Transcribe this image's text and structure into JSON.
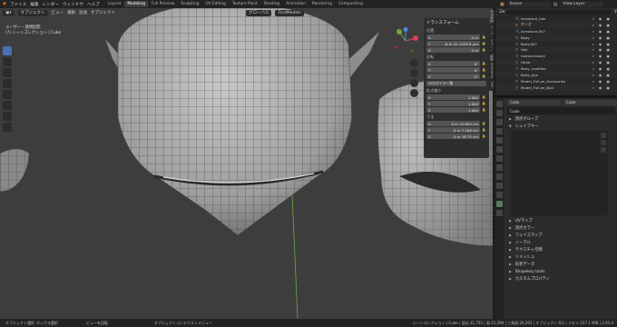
{
  "topbar": {
    "menu": [
      "ファイル",
      "編集",
      "レンダー",
      "ウィンドウ",
      "ヘルプ"
    ],
    "workspaces": [
      "Layout",
      "Modeling",
      "Full Preview",
      "Sculpting",
      "UV Editing",
      "Texture Paint",
      "Shading",
      "Animation",
      "Rendering",
      "Compositing"
    ],
    "active_workspace": "Modeling",
    "scene": "Scene",
    "view_layer": "View Layer"
  },
  "viewport": {
    "header": [
      "オブジェクト",
      "ビュー",
      "選択",
      "追加",
      "オブジェクト"
    ],
    "orientation_label": "グローバル",
    "view_name": "ユーザー・透視投影",
    "collection_line": "(7) シーンコレクション | Cube",
    "find_label": "FindModels"
  },
  "npanel": {
    "title": "トランスフォーム",
    "location_label": "位置",
    "location": [
      {
        "axis": "X",
        "value": "0 m"
      },
      {
        "axis": "Y",
        "value": "-6 m 41.1433,9 μm"
      },
      {
        "axis": "Z",
        "value": "0 m"
      }
    ],
    "rotation_label": "回転",
    "rotation": [
      {
        "axis": "X",
        "value": "0°"
      },
      {
        "axis": "Y",
        "value": "0°"
      },
      {
        "axis": "Z",
        "value": "0°"
      }
    ],
    "rotation_mode": "XYZオイラー角",
    "scale_label": "拡大縮小",
    "scale": [
      {
        "axis": "X",
        "value": "1.000"
      },
      {
        "axis": "Y",
        "value": "1.000"
      },
      {
        "axis": "Z",
        "value": "1.000"
      }
    ],
    "dimensions_label": "寸法",
    "dimensions": [
      {
        "axis": "X",
        "value": "0 m 13.694 cm"
      },
      {
        "axis": "Y",
        "value": "0 m 7.168 cm"
      },
      {
        "axis": "Z",
        "value": "0 m 16.75 cm"
      }
    ],
    "tabs": [
      "アイテム",
      "ツール",
      "ビュー",
      "編集",
      "Animation",
      "Edit"
    ]
  },
  "outliner": {
    "rows": [
      {
        "name": "Armature_hair",
        "icon": "armature"
      },
      {
        "name": "ポーズ",
        "icon": "pose"
      },
      {
        "name": "Armature.007",
        "icon": "armature"
      },
      {
        "name": "Body",
        "icon": "mesh"
      },
      {
        "name": "Body.007",
        "icon": "mesh"
      },
      {
        "name": "Hair",
        "icon": "mesh"
      },
      {
        "name": "hairaccessory",
        "icon": "mesh"
      },
      {
        "name": "Head",
        "icon": "mesh"
      },
      {
        "name": "Body_modifier",
        "icon": "mesh"
      },
      {
        "name": "Body_eye",
        "icon": "mesh"
      },
      {
        "name": "Model_Full.pe_Accesories",
        "icon": "mesh"
      },
      {
        "name": "Model_Full.pe_Bod",
        "icon": "mesh"
      }
    ]
  },
  "properties": {
    "object_name": "Cube",
    "data_name": "Cube",
    "name_field": "Cube",
    "sections_top": [
      "頂点グループ",
      "シェイプキー"
    ],
    "sections_bottom": [
      "UVマップ",
      "頂点カラー",
      "フェイスマップ",
      "ノーマル",
      "テクスチャ空間",
      "リメッシュ",
      "形状データ",
      "Shapekey tools",
      "カスタムプロパティ"
    ]
  },
  "statusbar": {
    "left": "オブジェクト選択",
    "left2": "ボックス選択",
    "mid": "ビューを回転",
    "mid2": "オブジェクトコンテクストメニュー",
    "right": "シーンコレクション | Cube | 頂点:11,752 | 面:11,294 | 三角面:20,291 | オブジェクト:0/1 | メモリ:257.1 MiB | 2.93.4"
  },
  "colors": {
    "accent": "#4772b3",
    "viewport_bg": "#3d3d3d",
    "panel_bg": "#2e2e2e"
  }
}
